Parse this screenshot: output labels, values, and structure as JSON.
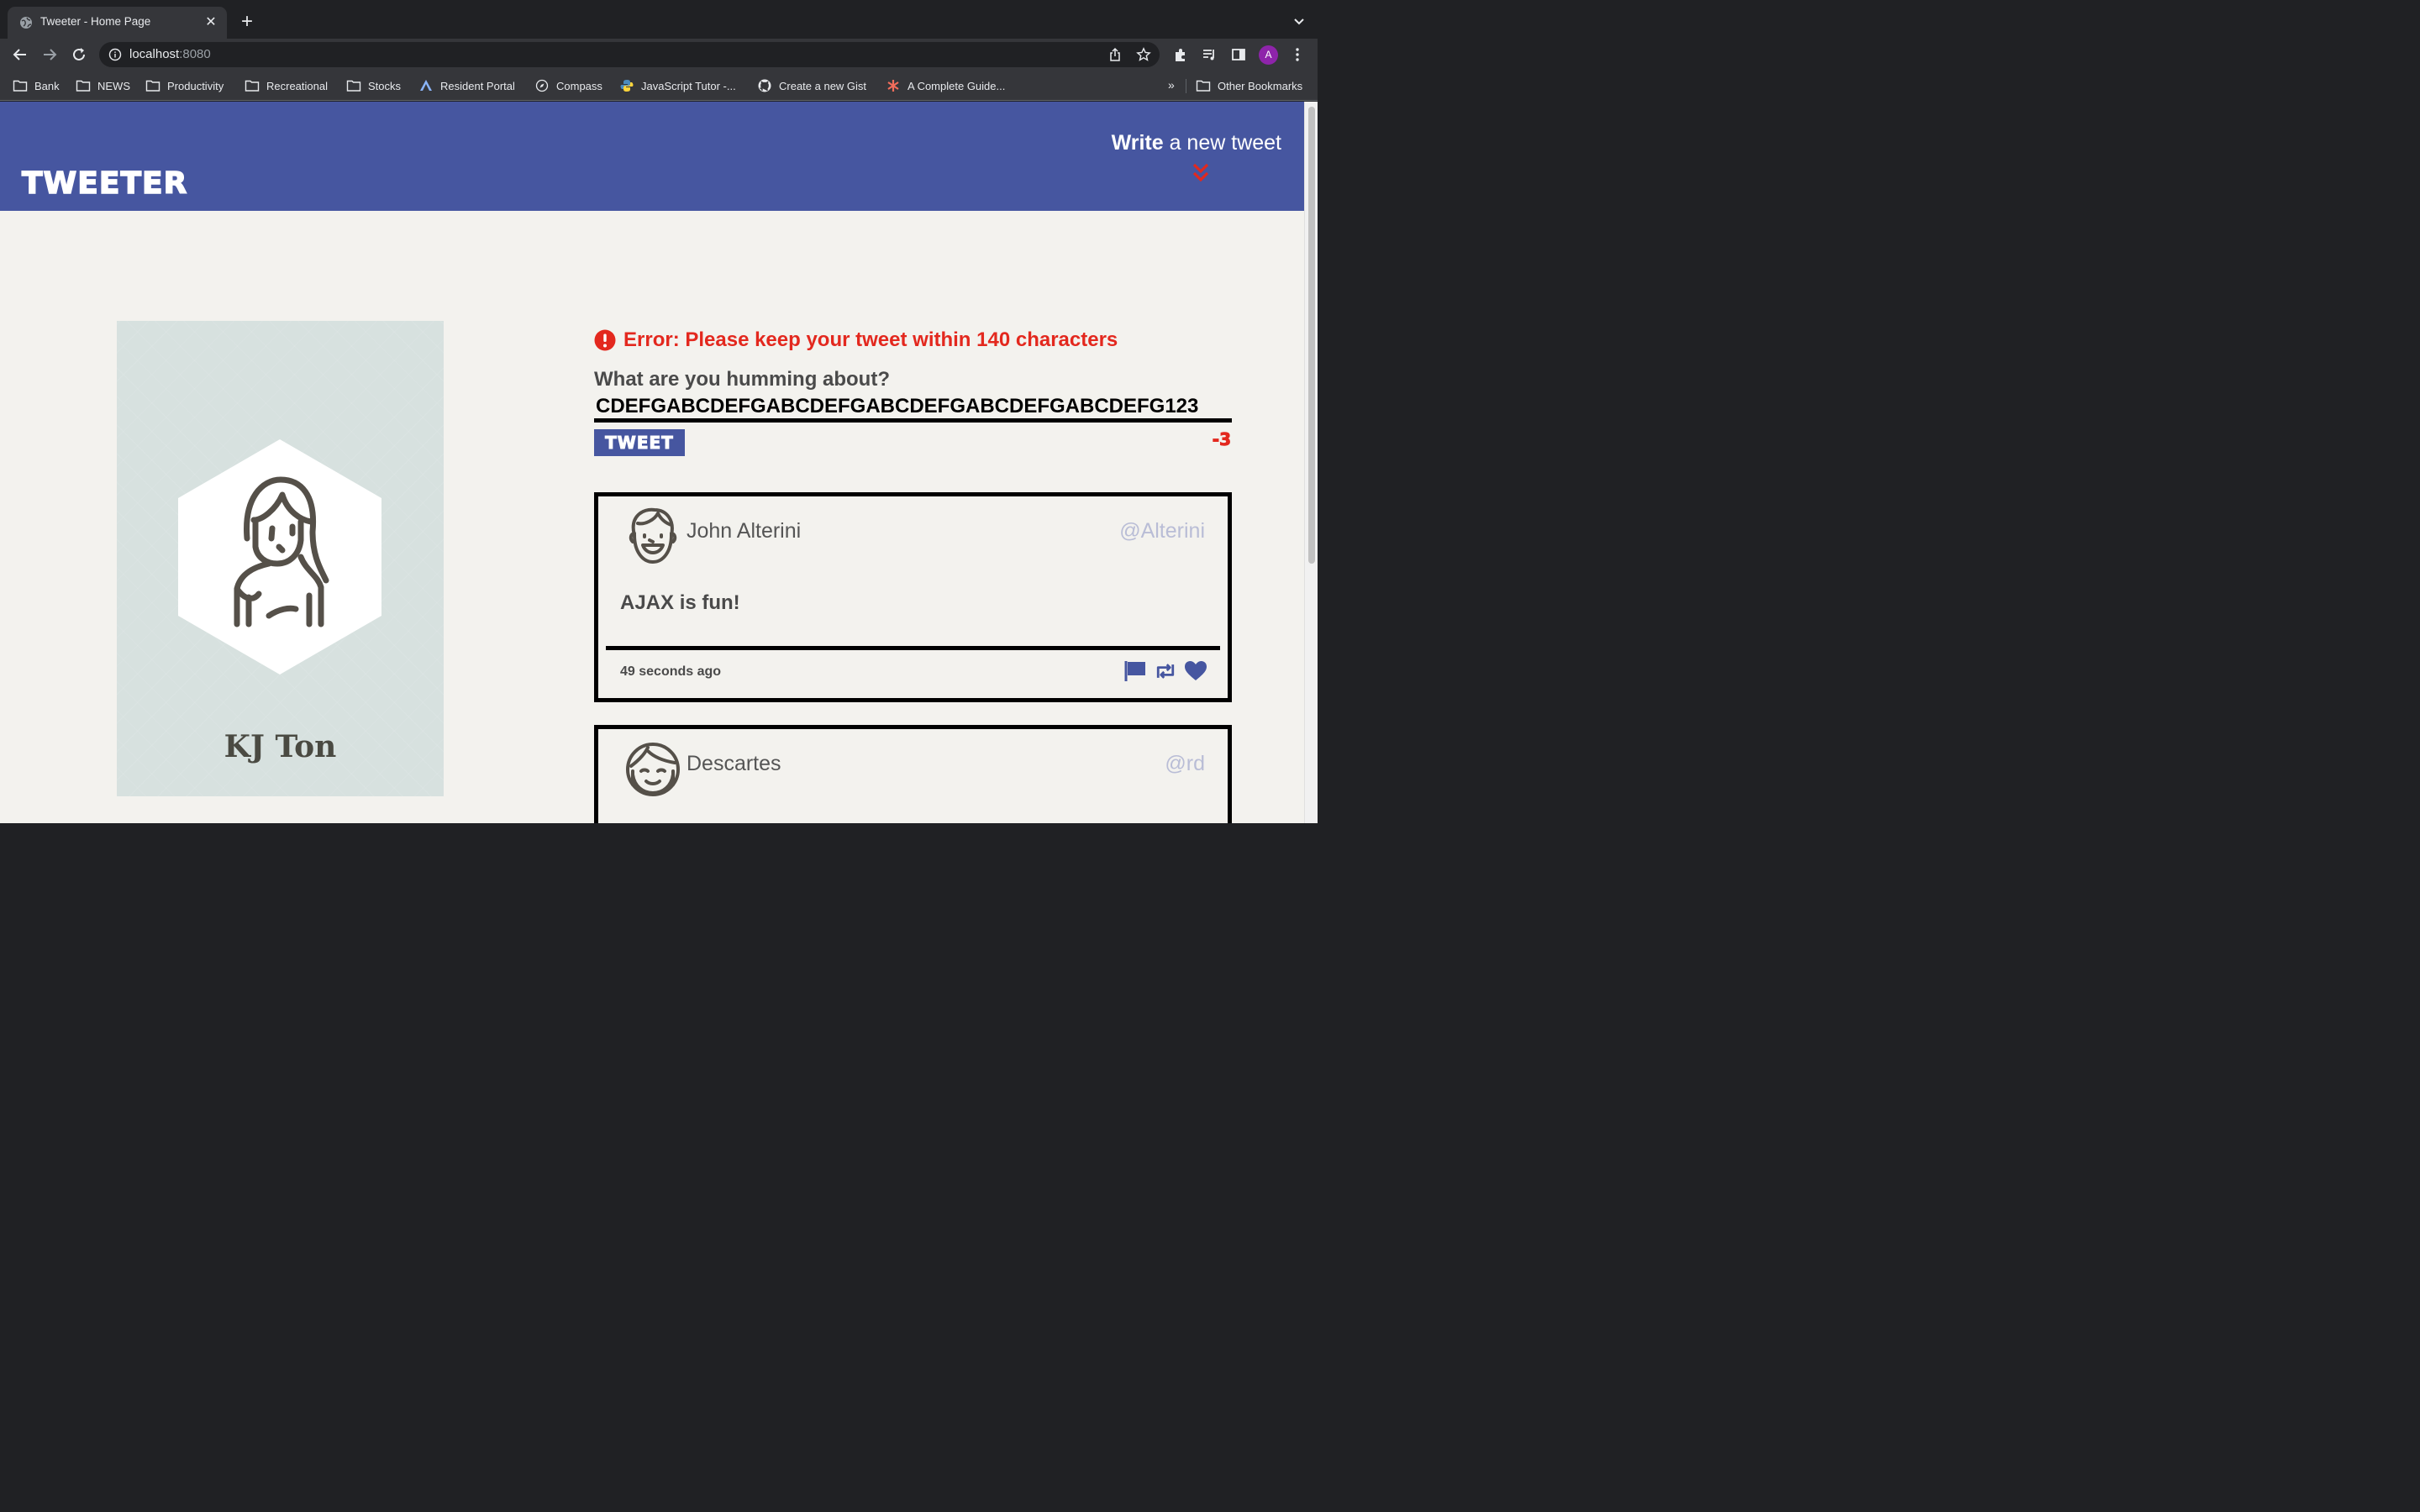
{
  "browser": {
    "tab_title": "Tweeter - Home Page",
    "url_host": "localhost",
    "url_port": ":8080",
    "profile_initial": "A",
    "bookmarks": [
      {
        "label": "Bank",
        "icon": "folder-icon"
      },
      {
        "label": "NEWS",
        "icon": "folder-icon"
      },
      {
        "label": "Productivity",
        "icon": "folder-icon"
      },
      {
        "label": "Recreational",
        "icon": "folder-icon"
      },
      {
        "label": "Stocks",
        "icon": "folder-icon"
      },
      {
        "label": "Resident Portal",
        "icon": "portal-icon"
      },
      {
        "label": "Compass",
        "icon": "compass-icon"
      },
      {
        "label": "JavaScript Tutor -...",
        "icon": "python-icon"
      },
      {
        "label": "Create a new Gist",
        "icon": "github-icon"
      },
      {
        "label": "A Complete Guide...",
        "icon": "asterisk-icon"
      }
    ],
    "bookmarks_overflow": "»",
    "other_bookmarks": "Other Bookmarks"
  },
  "nav": {
    "brand": "TWEETER",
    "write_bold": "Write",
    "write_rest": " a new tweet",
    "accent": "#4656a0"
  },
  "profile": {
    "name": "KJ Ton"
  },
  "compose": {
    "error": "Error: Please keep your tweet within 140 characters",
    "label": "What are you humming about?",
    "value": "CDEFGABCDEFGABCDEFGABCDEFGABCDEFGABCDEFG123",
    "button": "TWEET",
    "counter": "-3",
    "error_color": "#e3281e"
  },
  "tweets": [
    {
      "name": "John Alterini",
      "handle": "@Alterini",
      "text": "AJAX is fun!",
      "time": "49 seconds ago",
      "actions": [
        "flag-icon",
        "retweet-icon",
        "heart-icon"
      ]
    },
    {
      "name": "Descartes",
      "handle": "@rd"
    }
  ]
}
